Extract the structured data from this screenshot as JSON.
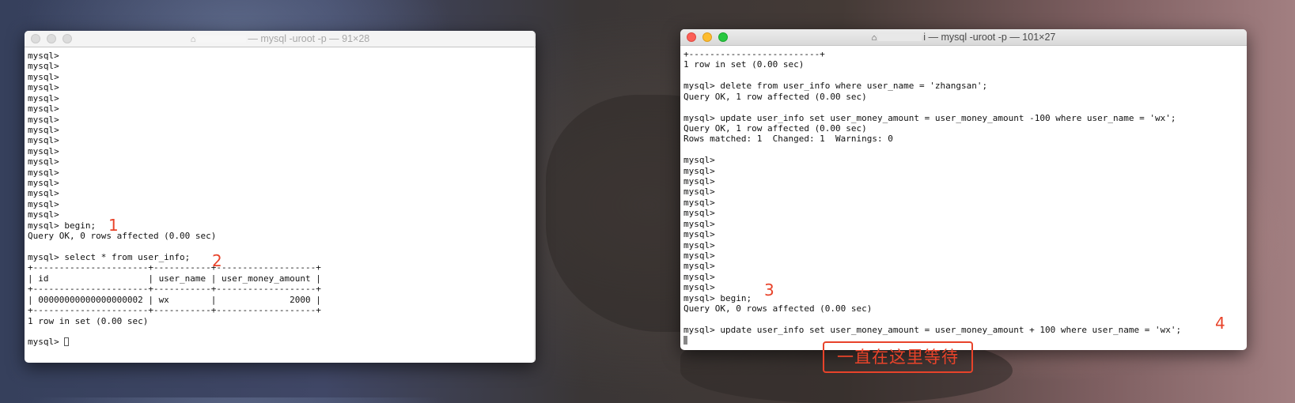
{
  "left_window": {
    "title_suffix": "— mysql -uroot -p — 91×28",
    "lines": [
      "mysql>",
      "mysql>",
      "mysql>",
      "mysql>",
      "mysql>",
      "mysql>",
      "mysql>",
      "mysql>",
      "mysql>",
      "mysql>",
      "mysql>",
      "mysql>",
      "mysql>",
      "mysql>",
      "mysql>",
      "mysql>",
      "mysql> begin;",
      "Query OK, 0 rows affected (0.00 sec)",
      "",
      "mysql> select * from user_info;",
      "+----------------------+-----------+-------------------+",
      "| id                   | user_name | user_money_amount |",
      "+----------------------+-----------+-------------------+",
      "| 00000000000000000002 | wx        |              2000 |",
      "+----------------------+-----------+-------------------+",
      "1 row in set (0.00 sec)",
      ""
    ],
    "prompt": "mysql> "
  },
  "right_window": {
    "title_suffix": "i — mysql -uroot -p — 101×27",
    "lines": [
      "+-------------------------+",
      "1 row in set (0.00 sec)",
      "",
      "mysql> delete from user_info where user_name = 'zhangsan';",
      "Query OK, 1 row affected (0.00 sec)",
      "",
      "mysql> update user_info set user_money_amount = user_money_amount -100 where user_name = 'wx';",
      "Query OK, 1 row affected (0.00 sec)",
      "Rows matched: 1  Changed: 1  Warnings: 0",
      "",
      "mysql>",
      "mysql>",
      "mysql>",
      "mysql>",
      "mysql>",
      "mysql>",
      "mysql>",
      "mysql>",
      "mysql>",
      "mysql>",
      "mysql>",
      "mysql>",
      "mysql>",
      "mysql> begin;",
      "Query OK, 0 rows affected (0.00 sec)",
      "",
      "mysql> update user_info set user_money_amount = user_money_amount + 100 where user_name = 'wx';"
    ]
  },
  "annotations": {
    "step1": "1",
    "step2": "2",
    "step3": "3",
    "step4": "4",
    "waiting_note": "一直在这里等待"
  },
  "colors": {
    "annotation": "#e8432a",
    "close": "#fc5f57",
    "minimize": "#fdbc2e",
    "zoom": "#28c840"
  }
}
